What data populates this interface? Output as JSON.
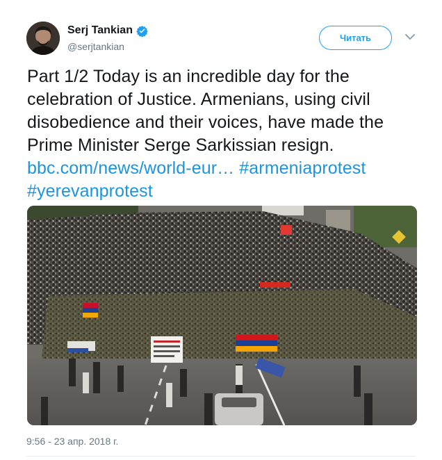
{
  "author": {
    "display_name": "Serj Tankian",
    "handle": "@serjtankian",
    "verified": true
  },
  "actions": {
    "follow_label": "Читать",
    "menu_icon": "chevron-down-icon"
  },
  "tweet": {
    "text_line_1": "Part 1/2 Today is an incredible day for the",
    "text_line_2": "celebration of Justice. Armenians, using civil",
    "text_line_3": "disobedience and their voices, have made the",
    "text_line_4": "Prime Minister Serge Sarkissian resign.",
    "link": "bbc.com/news/world-eur…",
    "hashtag_1": "#armeniaprotest",
    "hashtag_2": "#yerevanprotest",
    "timestamp": "9:56 - 23 апр. 2018 г."
  },
  "media": {
    "type": "photo",
    "description": "protest-crowd-photo"
  },
  "colors": {
    "accent": "#1da1f2",
    "link": "#1b95e0",
    "text": "#14171a",
    "secondary_text": "#657786"
  }
}
